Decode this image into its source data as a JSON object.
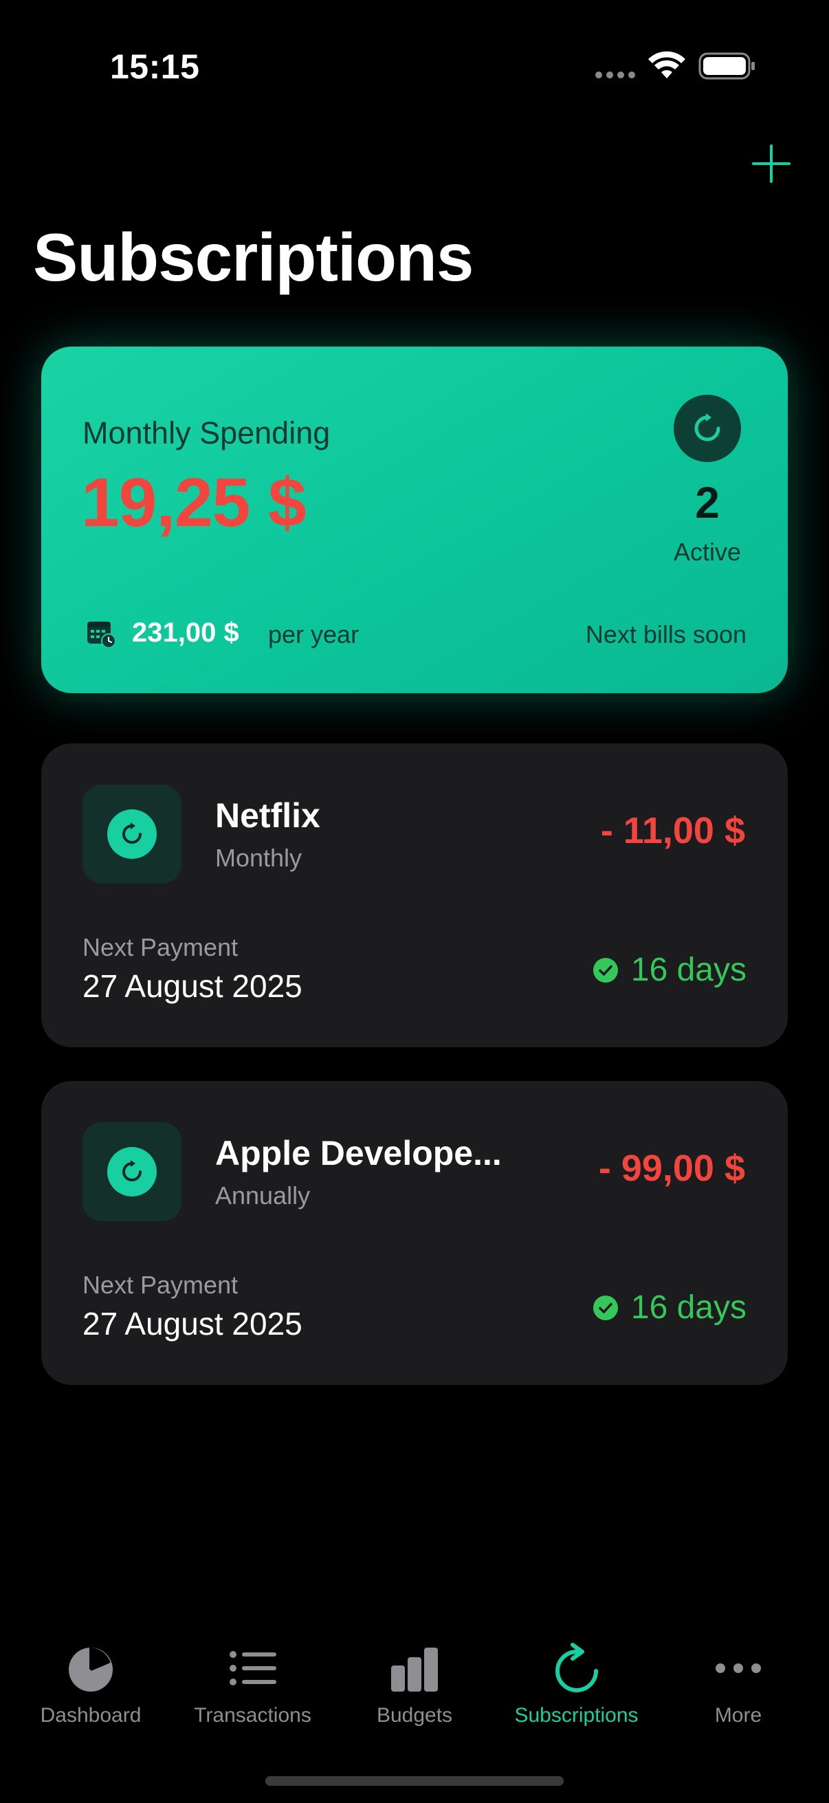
{
  "status_bar": {
    "time": "15:15",
    "icons": [
      "signal-dots-icon",
      "wifi-icon",
      "battery-icon"
    ]
  },
  "header": {
    "title": "Subscriptions",
    "add_icon": "plus-icon"
  },
  "summary": {
    "label": "Monthly Spending",
    "amount": "19,25 $",
    "active_count": "2",
    "active_label": "Active",
    "yearly_amount": "231,00 $",
    "yearly_suffix": "per year",
    "next_bills": "Next bills soon"
  },
  "subscriptions": [
    {
      "name": "Netflix",
      "cycle": "Monthly",
      "amount": "- 11,00 $",
      "next_label": "Next Payment",
      "next_date": "27 August 2025",
      "days": "16 days",
      "icon": "refresh-icon"
    },
    {
      "name": "Apple Develope...",
      "cycle": "Annually",
      "amount": "- 99,00 $",
      "next_label": "Next Payment",
      "next_date": "27 August 2025",
      "days": "16 days",
      "icon": "refresh-icon"
    }
  ],
  "tabs": [
    {
      "label": "Dashboard",
      "icon": "pie-chart-icon",
      "active": false
    },
    {
      "label": "Transactions",
      "icon": "list-icon",
      "active": false
    },
    {
      "label": "Budgets",
      "icon": "bar-chart-icon",
      "active": false
    },
    {
      "label": "Subscriptions",
      "icon": "refresh-icon",
      "active": true
    },
    {
      "label": "More",
      "icon": "more-dots-icon",
      "active": false
    }
  ],
  "colors": {
    "accent": "#17cfa0",
    "negative": "#f2453d",
    "positive": "#34c759",
    "card_bg": "#1c1c1e",
    "background": "#000000"
  }
}
